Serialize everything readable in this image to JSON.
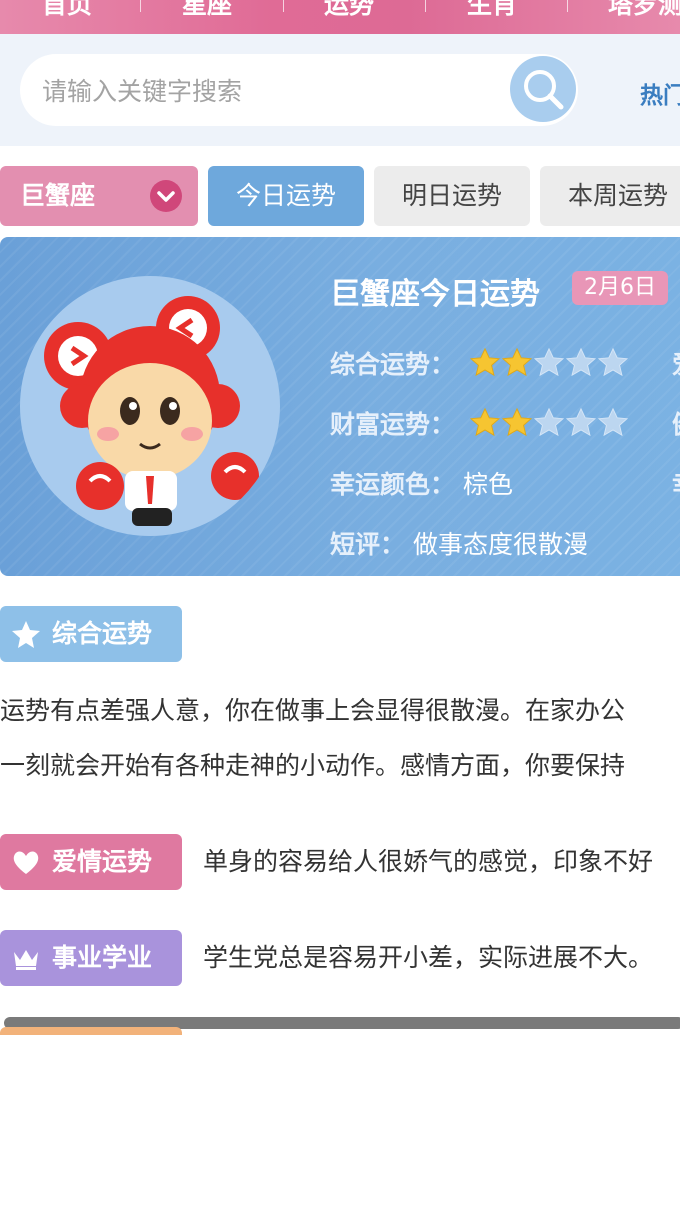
{
  "nav": {
    "items": [
      "首页",
      "星座",
      "运势",
      "生肖",
      "塔罗测"
    ]
  },
  "search": {
    "placeholder": "请输入关键字搜索",
    "hot_label": "热门"
  },
  "tabs": {
    "sign": "巨蟹座",
    "items": [
      {
        "label": "今日运势",
        "active": true
      },
      {
        "label": "明日运势",
        "active": false
      },
      {
        "label": "本周运势",
        "active": false
      }
    ]
  },
  "hero": {
    "title": "巨蟹座今日运势",
    "date": "2月6日",
    "overall_label": "综合运势：",
    "overall_stars": 2,
    "wealth_label": "财富运势：",
    "wealth_stars": 2,
    "lucky_color_label": "幸运颜色：",
    "lucky_color": "棕色",
    "comment_label": "短评：",
    "comment": "做事态度很散漫",
    "cut_1": "爱",
    "cut_2": "健",
    "cut_3": "幸"
  },
  "sections": {
    "overall": {
      "title": "综合运势",
      "line1": "运势有点差强人意，你在做事上会显得很散漫。在家办公",
      "line2": "一刻就会开始有各种走神的小动作。感情方面，你要保持"
    },
    "love": {
      "title": "爱情运势",
      "text": "单身的容易给人很娇气的感觉，印象不好"
    },
    "career": {
      "title": "事业学业",
      "text": "学生党总是容易开小差，实际进展不大。"
    }
  },
  "colors": {
    "pink": "#e38fb0",
    "blue": "#6ea8dc",
    "purple": "#a993dc",
    "star_gold": "#f6c531"
  }
}
